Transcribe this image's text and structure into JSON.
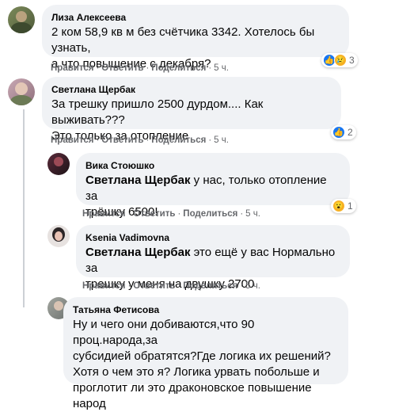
{
  "comments": [
    {
      "author": "Лиза Алексеева",
      "text": "2 ком 58,9 кв м без счётчика 3342. Хотелось бы узнать,\nа что повышение с декабря?",
      "mention": "",
      "like": "Нравится",
      "reply": "Ответить",
      "share": "Поделиться",
      "time": "5 ч.",
      "reactions_count": "3"
    },
    {
      "author": "Светлана Щербак",
      "text": "За трешку пришло 2500 дурдом.... Как выживать???\nЭто только за отопление",
      "mention": "",
      "like": "Нравится",
      "reply": "Ответить",
      "share": "Поделиться",
      "time": "5 ч.",
      "reactions_count": "2"
    },
    {
      "author": "Вика Стоюшко",
      "mention": "Светлана Щербак",
      "text": " у нас, только отопление за\nтрёшку 6500!",
      "like": "Нравится",
      "reply": "Ответить",
      "share": "Поделиться",
      "time": "5 ч.",
      "reactions_count": "1"
    },
    {
      "author": "Ksenia Vadimovna",
      "mention": "Светлана Щербак",
      "text": " это ещё у вас Нормально за\nтрешку у меня на двушку 2700",
      "like": "Нравится",
      "reply": "Ответить",
      "share": "Поделиться",
      "time": "5 ч."
    },
    {
      "author": "Татьяна Фетисова",
      "mention": "",
      "text": "Ну и чего они добиваются,что 90 проц.народа,за\nсубсидией обратятся?Где логика их решений?\nХотя о чем это я? Логика урвать побольше и\nпроглотит ли это драконовское повышение\nнарод"
    }
  ],
  "separator": "·",
  "colors": {
    "bubble": "#f0f2f5",
    "meta": "#65676b",
    "like": "#1877f2"
  }
}
